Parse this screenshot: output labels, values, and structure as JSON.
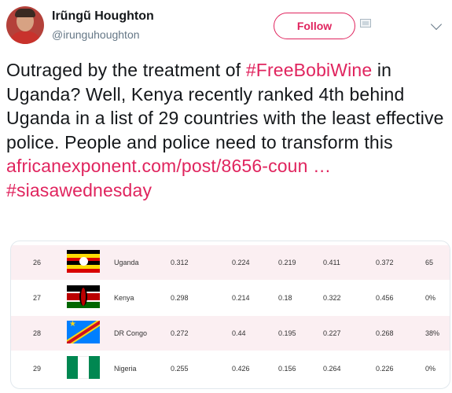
{
  "header": {
    "display_name": "Irũngũ Houghton",
    "handle": "@irunguhoughton",
    "follow_label": "Follow"
  },
  "tweet": {
    "text_1": "Outraged by the treatment of ",
    "hashtag_1": "#FreeBobiWine",
    "text_2": " in Uganda? Well, Kenya recently ranked 4th behind Uganda in a list of 29 countries with the least effective police. People and police need to transform this",
    "link": "africanexponent.com/post/8656-coun …",
    "hashtag_2": "#siasawednesday"
  },
  "table": {
    "rows": [
      {
        "rank": "26",
        "country": "Uganda",
        "v1": "0.312",
        "v2": "0.224",
        "v3": "0.219",
        "v4": "0.411",
        "v5": "0.372",
        "v6": "65"
      },
      {
        "rank": "27",
        "country": "Kenya",
        "v1": "0.298",
        "v2": "0.214",
        "v3": "0.18",
        "v4": "0.322",
        "v5": "0.456",
        "v6": "0%"
      },
      {
        "rank": "28",
        "country": "DR Congo",
        "v1": "0.272",
        "v2": "0.44",
        "v3": "0.195",
        "v4": "0.227",
        "v5": "0.268",
        "v6": "38%"
      },
      {
        "rank": "29",
        "country": "Nigeria",
        "v1": "0.255",
        "v2": "0.426",
        "v3": "0.156",
        "v4": "0.264",
        "v5": "0.226",
        "v6": "0%"
      }
    ]
  },
  "colors": {
    "accent": "#e0245e",
    "row_shade": "#fbeff2"
  },
  "icons": {
    "header_extra": "image-icon",
    "menu": "chevron-down-icon"
  }
}
